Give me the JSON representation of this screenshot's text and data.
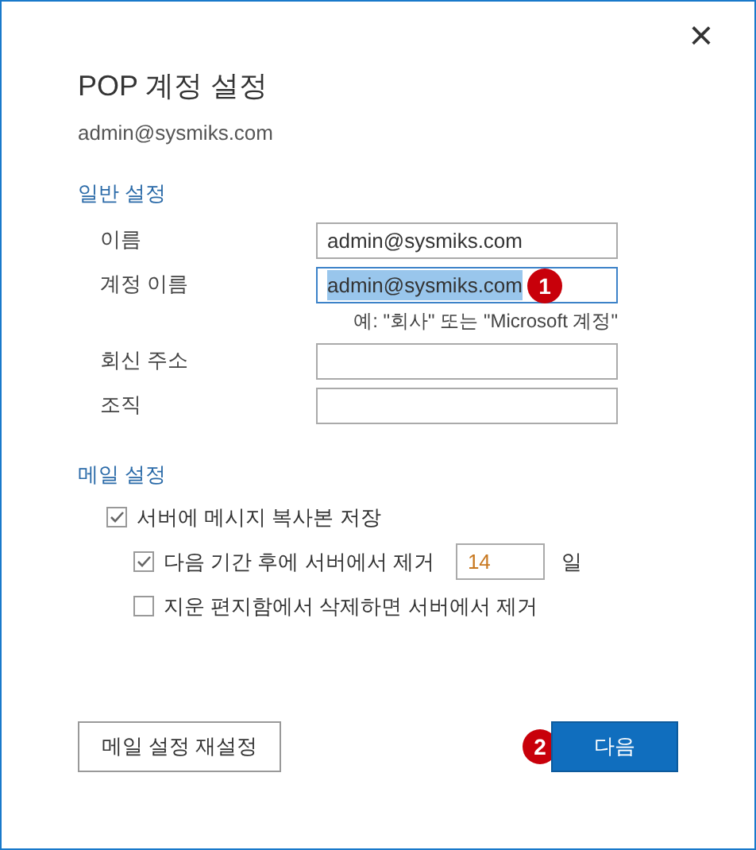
{
  "dialog": {
    "close": "×",
    "title": "POP 계정 설정",
    "subtitle": "admin@sysmiks.com"
  },
  "general_settings": {
    "heading": "일반 설정",
    "fields": [
      {
        "label": "이름",
        "value": "admin@sysmiks.com",
        "focused": false,
        "text_selected": false
      },
      {
        "label": "계정 이름",
        "value": "admin@sysmiks.com",
        "focused": true,
        "text_selected": true,
        "badge": "1",
        "hint": "예: \"회사\" 또는 \"Microsoft 계정\""
      },
      {
        "label": "회신 주소",
        "focused": false
      },
      {
        "label": "조직",
        "focused": false
      }
    ]
  },
  "mail_settings": {
    "heading": "메일 설정",
    "options": [
      {
        "label": "서버에 메시지 복사본 저장",
        "checked": true,
        "children": [
          {
            "label": "다음 기간 후에 서버에서 제거",
            "checked": true,
            "days_value": "14",
            "days_unit": "일"
          },
          {
            "label": "지운 편지함에서 삭제하면 서버에서 제거",
            "checked": false
          }
        ]
      }
    ]
  },
  "buttons": [
    {
      "label": "메일 설정 재설정",
      "kind": "secondary"
    },
    {
      "label": "다음",
      "kind": "primary",
      "badge": "2"
    }
  ]
}
